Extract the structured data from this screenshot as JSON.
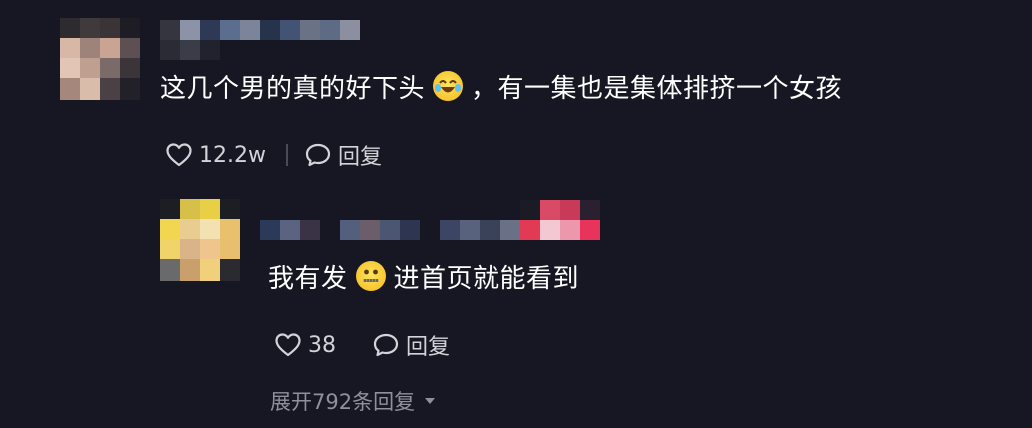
{
  "comment": {
    "text_before_emoji": "这几个男的真的好下头",
    "emoji": "laughing-crying-emoji",
    "text_after_emoji": "，有一集也是集体排挤一个女孩",
    "like_count": "12.2w",
    "reply_label": "回复"
  },
  "reply": {
    "text_before_emoji": "我有发",
    "emoji": "zipper-mouth-emoji",
    "text_after_emoji": "进首页就能看到",
    "like_count": "38",
    "reply_label": "回复"
  },
  "expand_replies_label": "展开792条回复",
  "colors": {
    "background": "#161722",
    "text_primary": "#ffffff",
    "text_secondary": "#d3d4da",
    "text_muted": "#8f909a"
  }
}
